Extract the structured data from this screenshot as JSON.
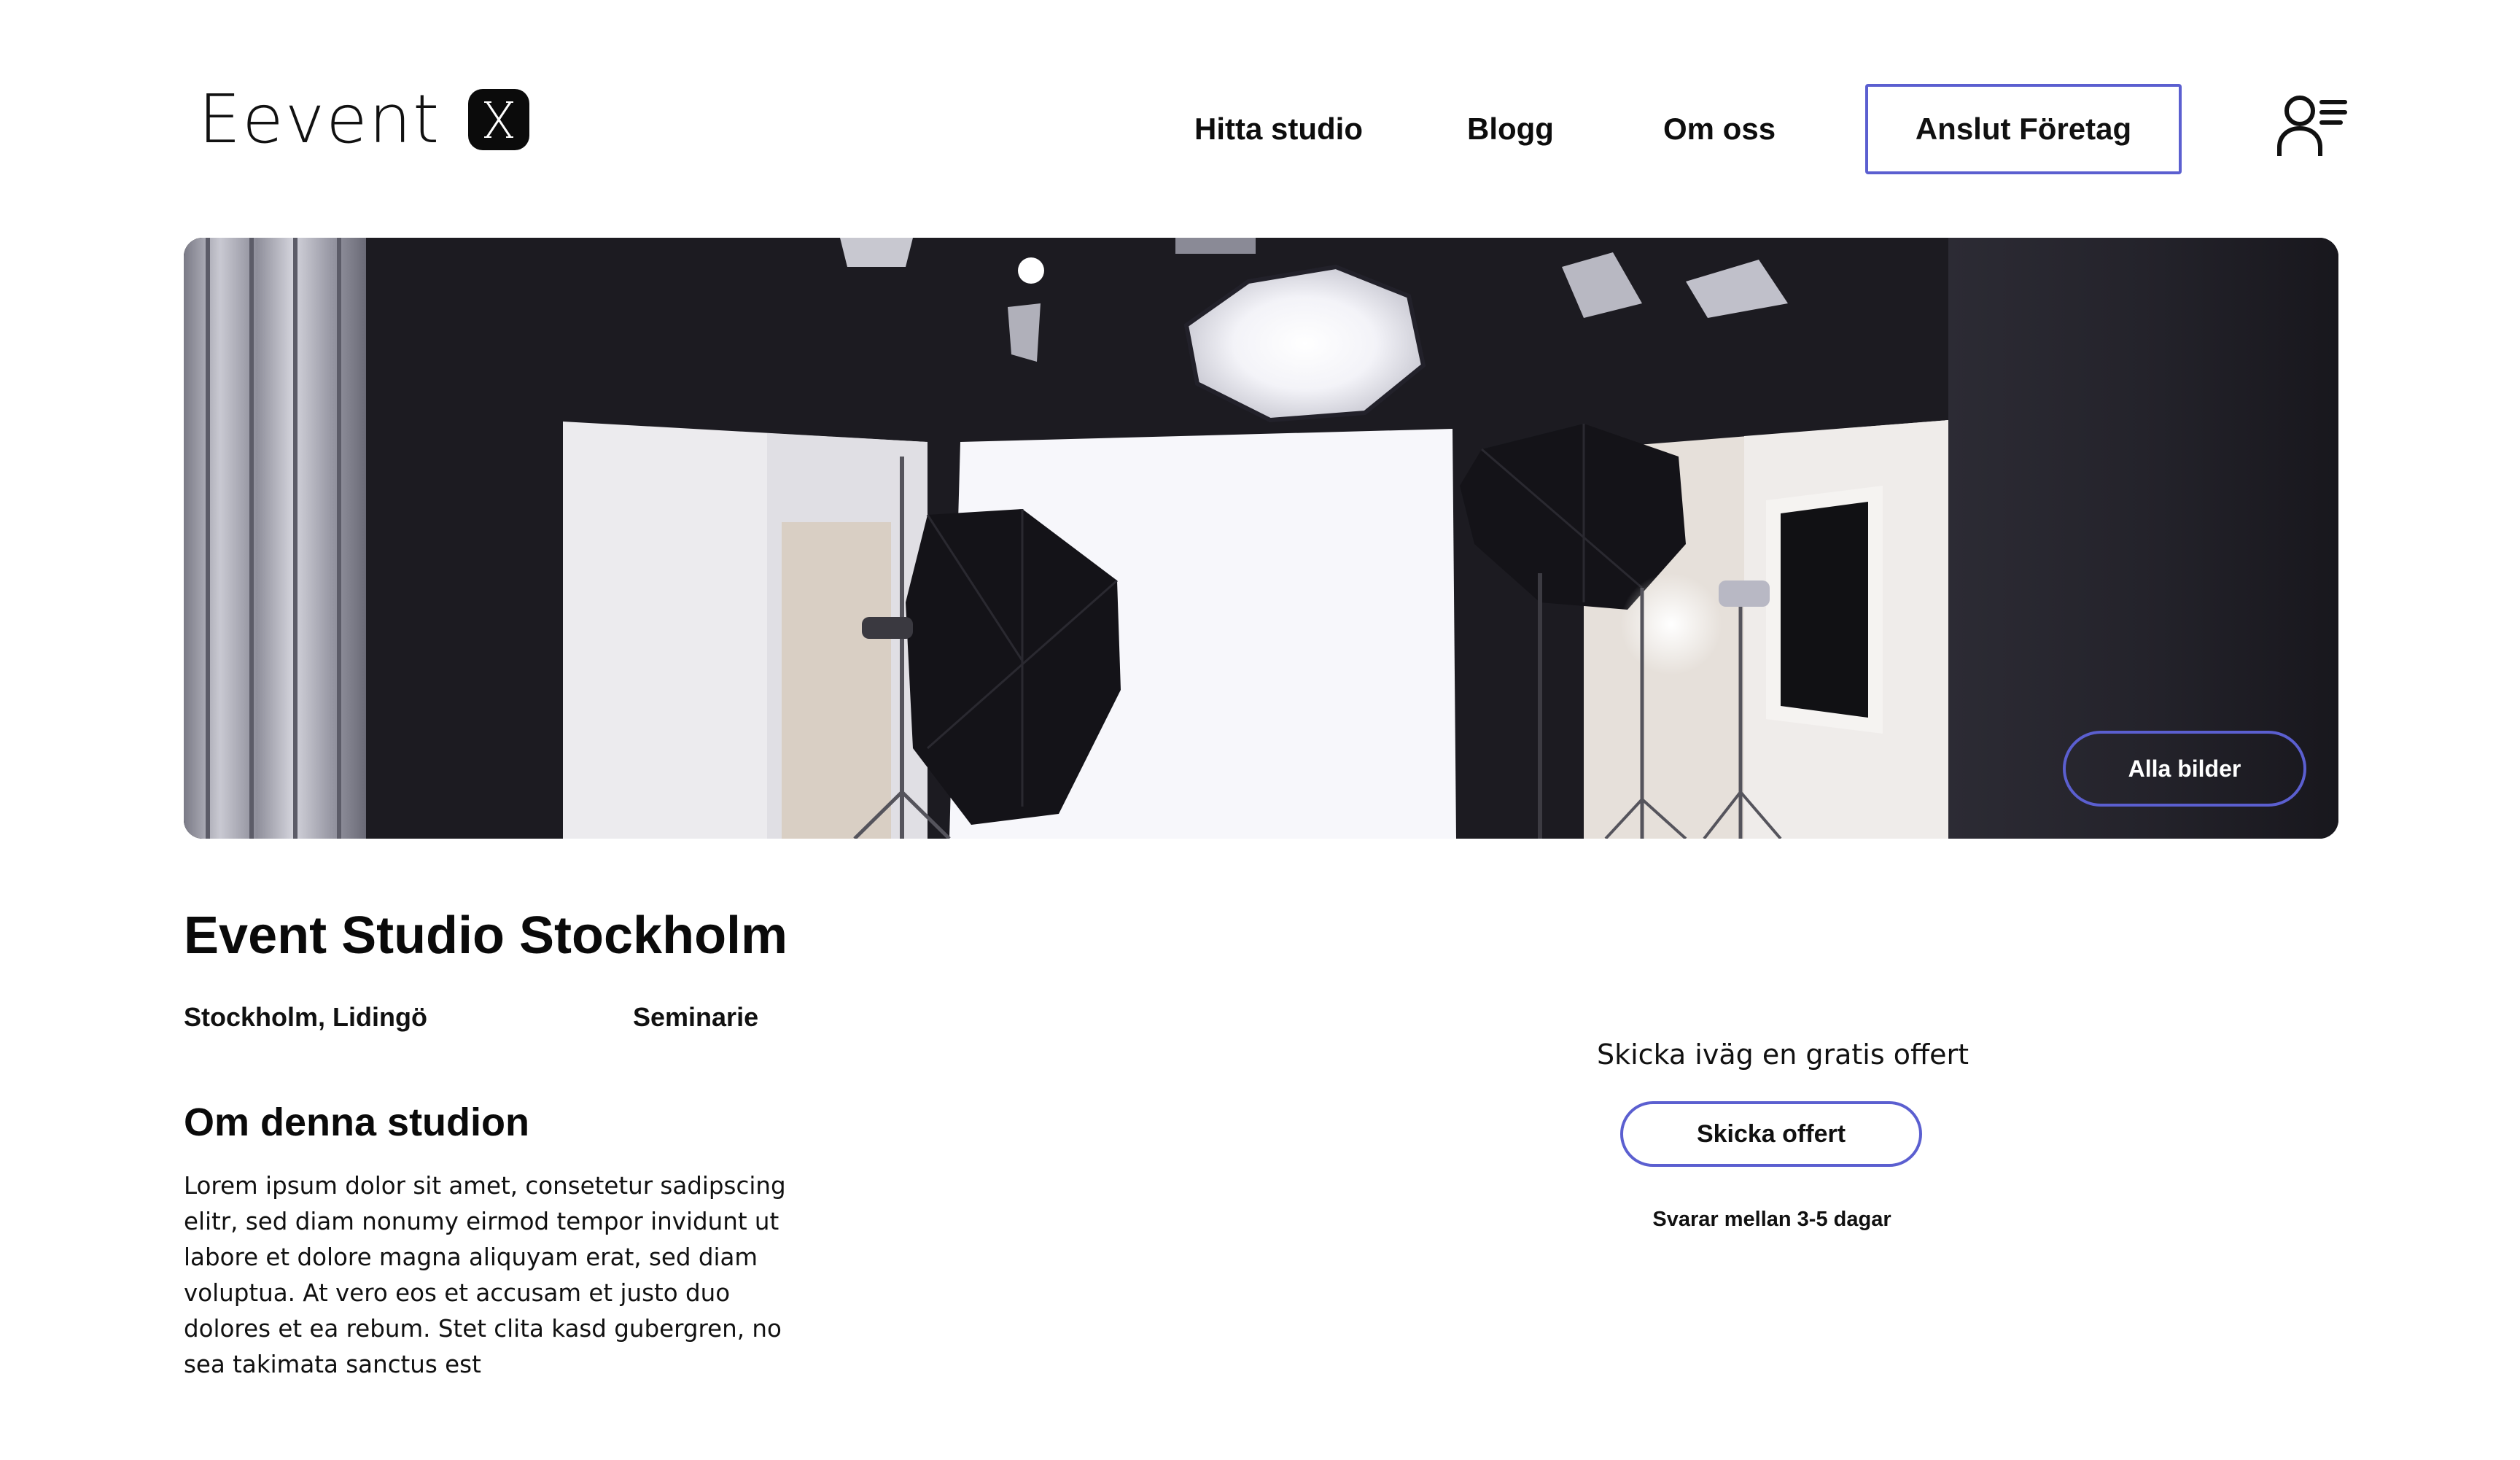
{
  "header": {
    "logo_text": "Eevent",
    "logo_mark_icon": "x-logo-icon",
    "nav": [
      {
        "label": "Hitta studio"
      },
      {
        "label": "Blogg"
      },
      {
        "label": "Om oss"
      }
    ],
    "join_button": "Anslut Företag",
    "profile_icon": "user-menu-icon"
  },
  "hero": {
    "all_images_button": "Alla bilder"
  },
  "studio": {
    "title": "Event Studio Stockholm",
    "location": "Stockholm, Lidingö",
    "category": "Seminarie",
    "about_title": "Om denna studion",
    "about_text": "Lorem ipsum dolor sit amet, consetetur sadipscing elitr, sed diam nonumy eirmod tempor invidunt ut labore et dolore magna aliquyam erat, sed diam voluptua. At vero eos et accusam et justo duo dolores et ea rebum. Stet clita kasd gubergren, no sea takimata sanctus est"
  },
  "offer": {
    "heading": "Skicka iväg en gratis offert",
    "button": "Skicka offert",
    "note": "Svarar mellan 3-5 dagar"
  },
  "colors": {
    "accent": "#5b5fd0",
    "text": "#111111",
    "background": "#ffffff"
  }
}
